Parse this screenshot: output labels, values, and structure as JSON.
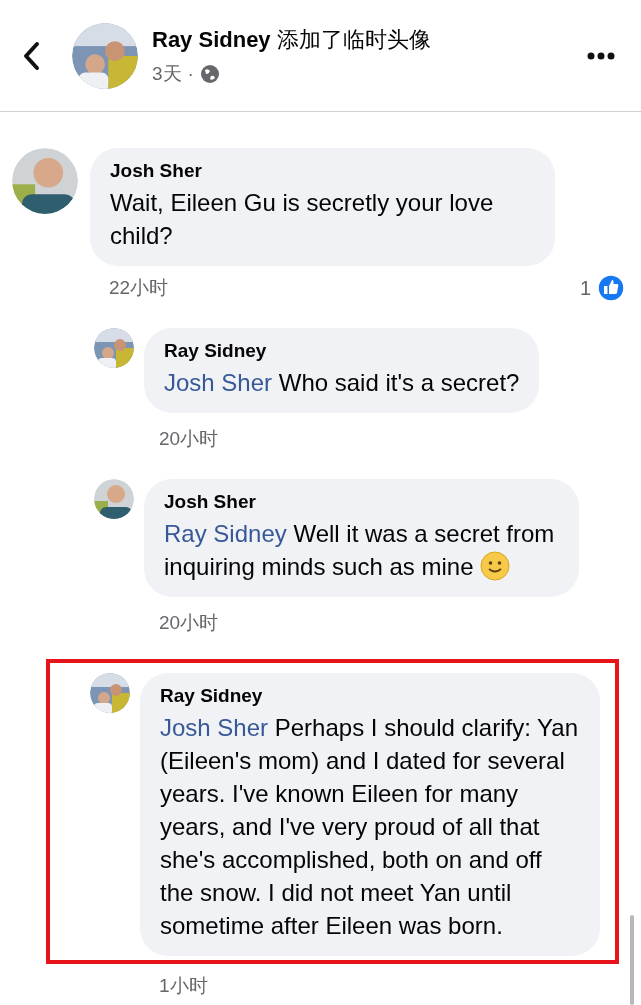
{
  "header": {
    "title": "**Ray Sidney** 添加了临时头像",
    "time": "3天",
    "separator": "·"
  },
  "comments": [
    {
      "author": "Josh Sher",
      "text": "Wait, Eileen Gu is secretly your love child?",
      "time": "22小时",
      "likes": "1",
      "highlighted": false,
      "replies": [
        {
          "author": "Ray Sidney",
          "mention": "Josh Sher",
          "text": "Who said it's a secret?",
          "time": "20小时",
          "highlighted": false
        },
        {
          "author": "Josh Sher",
          "mention": "Ray Sidney",
          "text": "Well it was a secret from inquiring minds such as mine",
          "smiley": true,
          "time": "20小时",
          "highlighted": false
        },
        {
          "author": "Ray Sidney",
          "mention": "Josh Sher",
          "text": "Perhaps I should clarify: Yan (Eileen's mom) and I dated for several years. I've known Eileen for many years, and I've very proud of all that she's accomplished, both on and off the snow. I did not meet Yan until sometime after Eileen was born.",
          "time": "1小时",
          "highlighted": true
        }
      ]
    }
  ]
}
